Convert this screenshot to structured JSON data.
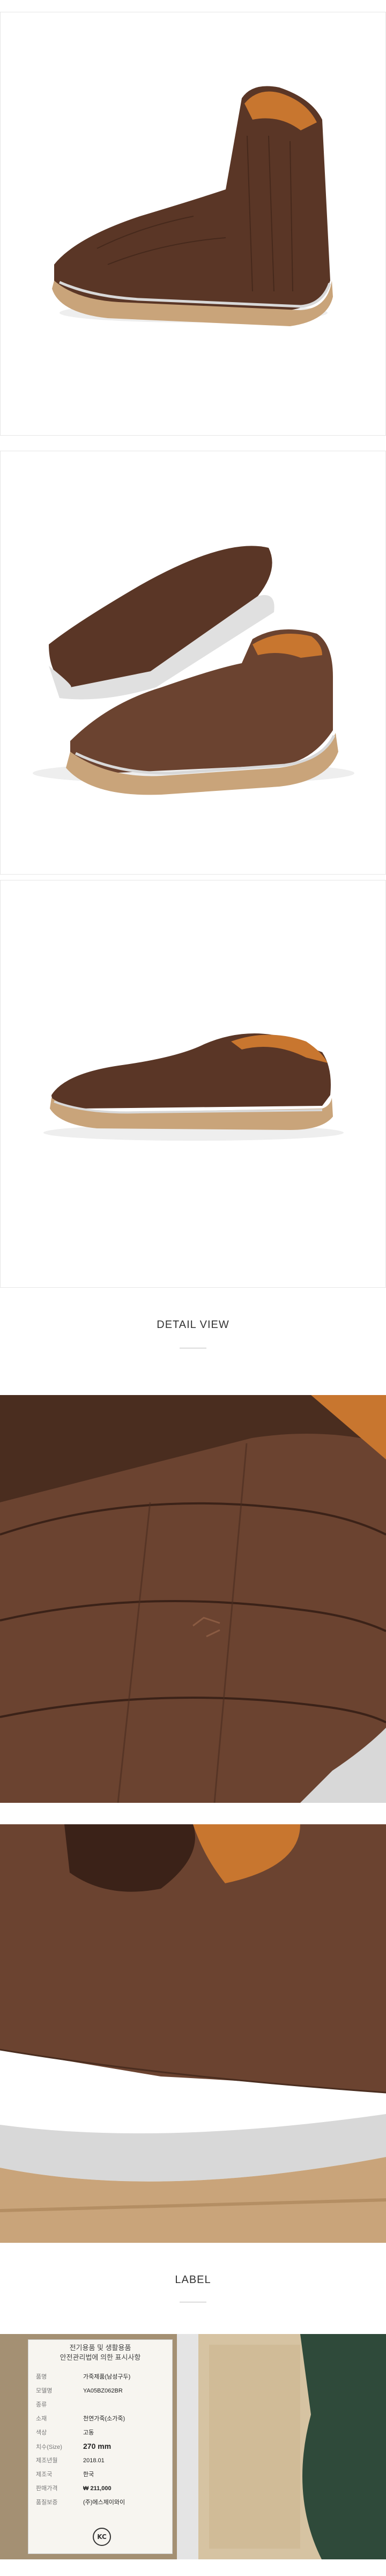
{
  "sections": {
    "detail_title": "DETAIL VIEW",
    "label_title": "LABEL"
  },
  "label": {
    "header_line1": "전기용품 및 생활용품",
    "header_line2": "안전관리법에 의한 표시사항",
    "rows": [
      {
        "k": "품명",
        "v": "가죽제품(남성구두)"
      },
      {
        "k": "모델명",
        "v": "YA05BZ062BR"
      },
      {
        "k": "종류",
        "v": ""
      },
      {
        "k": "소재",
        "v": "천연가죽(소가죽)"
      },
      {
        "k": "색상",
        "v": "고동"
      },
      {
        "k": "치수(Size)",
        "v": "270 mm"
      },
      {
        "k": "제조년월",
        "v": "2018.01"
      },
      {
        "k": "제조국",
        "v": "한국"
      },
      {
        "k": "판매가격",
        "v": "₩ 211,000"
      },
      {
        "k": "품질보증",
        "v": "(주)에스제이와이"
      }
    ],
    "certification_mark": "KC"
  },
  "colors": {
    "leather_dark": "#4a2d1f",
    "leather_mid": "#6b4330",
    "leather_light": "#8a5b42",
    "sole_tan": "#c9a47a",
    "sole_silver": "#d8d8d8",
    "lining_orange": "#c8762f"
  }
}
